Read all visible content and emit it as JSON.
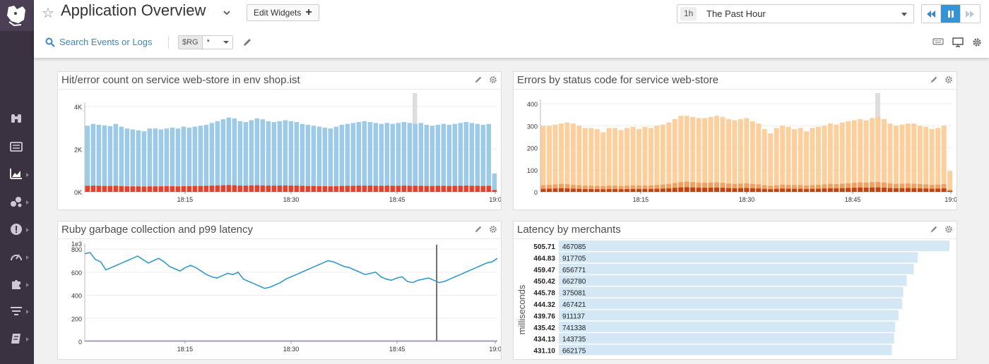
{
  "header": {
    "title": "Application Overview",
    "edit_widgets_label": "Edit Widgets",
    "timeframe_badge": "1h",
    "timeframe_label": "The Past Hour",
    "search_label": "Search Events or Logs",
    "template_var_name": "$RG",
    "template_var_value": "*"
  },
  "leftnav": {
    "icons": [
      "binoculars-icon",
      "list-icon",
      "dashboard-icon",
      "infrastructure-icon",
      "monitors-icon",
      "apm-icon",
      "integrations-icon",
      "logs-icon",
      "notebook-icon"
    ]
  },
  "colors": {
    "hits": "#9dcbe6",
    "errors": "#e8402a",
    "status_light": "#fdcf9d",
    "status_dark": "#c4420e",
    "line": "#3399cc",
    "toplist_bar": "#d3e7f4",
    "active_button": "#3495d6"
  },
  "widgets": [
    {
      "title": "Hit/error count on service web-store in env shop.ist"
    },
    {
      "title": "Errors by status code for service web-store"
    },
    {
      "title": "Ruby garbage collection and p99 latency"
    },
    {
      "title": "Latency by merchants"
    }
  ],
  "chart_data": [
    {
      "type": "bar",
      "title": "Hit/error count on service web-store in env shop.ist",
      "xticks": [
        "18:15",
        "18:30",
        "18:45",
        "19:0"
      ],
      "yticks": [
        "0K",
        "2K",
        "4K"
      ],
      "ylim": [
        0,
        4800
      ],
      "series": [
        {
          "values": [
            3600,
            3700,
            3650,
            3620,
            3580,
            3700,
            3550,
            3450,
            3400,
            3350,
            3300,
            3450,
            3450,
            3400,
            3450,
            3500,
            3450,
            3550,
            3500,
            3550,
            3600,
            3650,
            3750,
            3850,
            3950,
            4050,
            4000,
            3850,
            3800,
            3900,
            4000,
            3950,
            3850,
            3800,
            3850,
            3900,
            3850,
            3800,
            3700,
            3650,
            3600,
            3550,
            3500,
            3450,
            3550,
            3650,
            3700,
            3750,
            3800,
            3850,
            3800,
            3750,
            3700,
            3750,
            3700,
            3750,
            3800,
            3750,
            3700,
            3750,
            3650,
            3600,
            3650,
            3700,
            3650,
            3700,
            3750,
            3800,
            3750,
            3700,
            3650,
            3700,
            1000
          ]
        },
        {
          "values": [
            330,
            340,
            330,
            320,
            320,
            330,
            310,
            300,
            300,
            300,
            290,
            300,
            300,
            300,
            310,
            310,
            300,
            310,
            310,
            320,
            320,
            330,
            340,
            350,
            360,
            370,
            360,
            340,
            340,
            350,
            360,
            350,
            340,
            340,
            340,
            350,
            340,
            340,
            330,
            320,
            320,
            310,
            310,
            300,
            310,
            320,
            330,
            330,
            340,
            340,
            340,
            330,
            330,
            340,
            330,
            330,
            340,
            330,
            330,
            330,
            320,
            320,
            330,
            330,
            320,
            330,
            330,
            340,
            330,
            330,
            320,
            330,
            100
          ]
        }
      ]
    },
    {
      "type": "bar",
      "title": "Errors by status code for service web-store",
      "xticks": [
        "18:15",
        "18:30",
        "18:45",
        "19:0"
      ],
      "yticks": [
        "0",
        "100",
        "200",
        "300",
        "400"
      ],
      "ylim": [
        0,
        400
      ],
      "series": [
        {
          "values": [
            300,
            300,
            305,
            310,
            315,
            310,
            300,
            290,
            290,
            285,
            270,
            290,
            290,
            280,
            290,
            295,
            285,
            295,
            290,
            300,
            305,
            315,
            330,
            345,
            345,
            340,
            335,
            335,
            340,
            345,
            340,
            330,
            325,
            330,
            335,
            320,
            310,
            285,
            265,
            290,
            300,
            295,
            285,
            290,
            275,
            290,
            295,
            300,
            310,
            305,
            315,
            320,
            325,
            330,
            325,
            335,
            340,
            330,
            310,
            300,
            305,
            310,
            310,
            300,
            295,
            285,
            290,
            300,
            95
          ]
        },
        {
          "values": [
            30,
            32,
            34,
            36,
            35,
            32,
            30,
            28,
            28,
            27,
            26,
            28,
            28,
            27,
            28,
            29,
            28,
            29,
            29,
            31,
            33,
            36,
            40,
            44,
            46,
            44,
            42,
            41,
            42,
            43,
            41,
            38,
            36,
            37,
            39,
            36,
            34,
            30,
            27,
            30,
            33,
            32,
            31,
            31,
            29,
            31,
            32,
            34,
            36,
            35,
            37,
            39,
            41,
            43,
            42,
            44,
            45,
            42,
            38,
            36,
            37,
            38,
            37,
            35,
            34,
            32,
            33,
            35,
            10
          ]
        }
      ]
    },
    {
      "type": "line",
      "title": "Ruby garbage collection and p99 latency",
      "axis_label": "1e3",
      "xticks": [
        "18:15",
        "18:30",
        "18:45",
        "19:0"
      ],
      "yticks": [
        "0",
        "200",
        "400",
        "600",
        "800"
      ],
      "ylim": [
        0,
        850
      ],
      "series": [
        {
          "values": [
            760,
            770,
            710,
            690,
            620,
            640,
            660,
            680,
            700,
            720,
            740,
            710,
            680,
            700,
            720,
            690,
            650,
            630,
            610,
            640,
            660,
            640,
            610,
            580,
            560,
            550,
            570,
            590,
            580,
            600,
            540,
            520,
            500,
            480,
            460,
            470,
            490,
            510,
            540,
            560,
            580,
            600,
            620,
            640,
            660,
            680,
            700,
            690,
            670,
            650,
            640,
            620,
            600,
            580,
            590,
            600,
            560,
            540,
            530,
            550,
            560,
            520,
            510,
            530,
            540,
            550,
            530,
            510,
            520,
            540,
            560,
            580,
            600,
            620,
            640,
            660,
            680,
            690,
            720
          ]
        },
        {
          "values": [
            5,
            5,
            5,
            5,
            5,
            5,
            5,
            5,
            5,
            5,
            5,
            5,
            5,
            5,
            5,
            5,
            5,
            5,
            5,
            5,
            5,
            5,
            5,
            5,
            5,
            5,
            5,
            5,
            5,
            5,
            5,
            5,
            5,
            5,
            5,
            5,
            5,
            5,
            5,
            5,
            5,
            5,
            5,
            5,
            5,
            5,
            5,
            5,
            5,
            5,
            5,
            5,
            5,
            5,
            5,
            5,
            5,
            5,
            5,
            5,
            5,
            5,
            5,
            5,
            5,
            5,
            5,
            5,
            5,
            5,
            5,
            5,
            5,
            5,
            5,
            5,
            5,
            5,
            5
          ]
        }
      ]
    },
    {
      "type": "bar",
      "title": "Latency by merchants",
      "ylabel": "milliseconds",
      "rows": [
        {
          "value": "505.71",
          "label": "467085",
          "v": 505.71
        },
        {
          "value": "464.83",
          "label": "917705",
          "v": 464.83
        },
        {
          "value": "459.47",
          "label": "656771",
          "v": 459.47
        },
        {
          "value": "450.42",
          "label": "662780",
          "v": 450.42
        },
        {
          "value": "445.78",
          "label": "375081",
          "v": 445.78
        },
        {
          "value": "444.32",
          "label": "467421",
          "v": 444.32
        },
        {
          "value": "439.76",
          "label": "911137",
          "v": 439.76
        },
        {
          "value": "435.42",
          "label": "741338",
          "v": 435.42
        },
        {
          "value": "434.13",
          "label": "143735",
          "v": 434.13
        },
        {
          "value": "431.10",
          "label": "662175",
          "v": 431.1
        }
      ]
    }
  ]
}
